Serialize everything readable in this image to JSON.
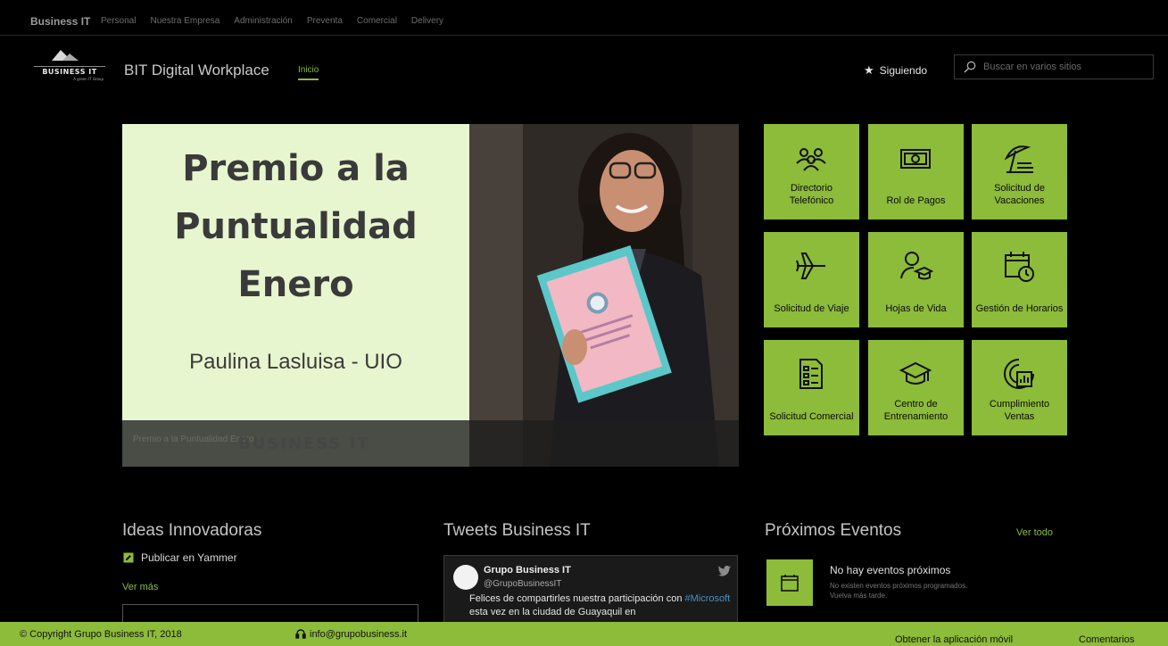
{
  "suitebar": {
    "brand": "Business IT",
    "items": [
      "Personal",
      "Nuestra Empresa",
      "Administración",
      "Preventa",
      "Comercial",
      "Delivery"
    ]
  },
  "header": {
    "logo_text": "BUSINESS IT",
    "logo_sub": "A green IT Group",
    "site_title": "BIT Digital Workplace",
    "nav_home": "Inicio",
    "follow_label": "Siguiendo",
    "search_placeholder": "Buscar en varios sitios"
  },
  "hero": {
    "heading_lines": [
      "Premio a la",
      "Puntualidad",
      "Enero"
    ],
    "name": "Paulina Lasluisa - UIO",
    "caption": "Premio a la Puntualidad Enero",
    "caption_logo": "BUSINESS IT"
  },
  "tiles": [
    {
      "label": "Directorio Telefónico",
      "icon": "people-icon"
    },
    {
      "label": "Rol de Pagos",
      "icon": "money-icon"
    },
    {
      "label": "Solicitud de Vacaciones",
      "icon": "beach-umbrella-icon"
    },
    {
      "label": "Solicitud de Viaje",
      "icon": "airplane-icon"
    },
    {
      "label": "Hojas de Vida",
      "icon": "person-graduate-icon"
    },
    {
      "label": "Gestión de Horarios",
      "icon": "calendar-clock-icon"
    },
    {
      "label": "Solicitud Comercial",
      "icon": "form-icon"
    },
    {
      "label": "Centro de Entrenamiento",
      "icon": "mortarboard-icon"
    },
    {
      "label": "Cumplimiento Ventas",
      "icon": "target-chart-icon"
    }
  ],
  "ideas": {
    "title": "Ideas Innovadoras",
    "yammer_label": "Publicar en Yammer",
    "ver_mas": "Ver más"
  },
  "tweets": {
    "title": "Tweets Business IT",
    "name": "Grupo Business IT",
    "handle": "@GrupoBusinessIT",
    "text_before": "Felices de compartirles nuestra participación con ",
    "hashtag": "#Microsoft",
    "text_after": " esta vez en la ciudad de Guayaquil en"
  },
  "events": {
    "title": "Próximos Eventos",
    "ver_todo": "Ver todo",
    "empty_title": "No hay eventos próximos",
    "empty_sub": "No existen eventos próximos programados. Vuelva más tarde."
  },
  "footer": {
    "copyright": "© Copyright Grupo Business IT, 2018",
    "email": "info@grupobusiness.it",
    "app_label": "Obtener la aplicación móvil",
    "comments_label": "Comentarios"
  },
  "colors": {
    "accent": "#8dbb3a",
    "background": "#000000"
  }
}
